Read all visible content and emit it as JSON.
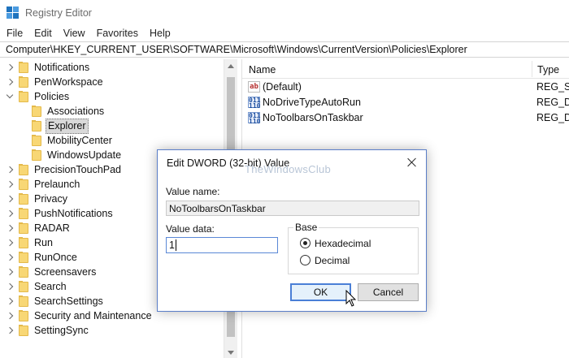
{
  "window": {
    "title": "Registry Editor"
  },
  "menu": [
    "File",
    "Edit",
    "View",
    "Favorites",
    "Help"
  ],
  "address": "Computer\\HKEY_CURRENT_USER\\SOFTWARE\\Microsoft\\Windows\\CurrentVersion\\Policies\\Explorer",
  "tree": {
    "items": [
      {
        "label": "Notifications",
        "level": 0,
        "expander": "collapsed"
      },
      {
        "label": "PenWorkspace",
        "level": 0,
        "expander": "collapsed"
      },
      {
        "label": "Policies",
        "level": 0,
        "expander": "expanded"
      },
      {
        "label": "Associations",
        "level": 1,
        "expander": "none"
      },
      {
        "label": "Explorer",
        "level": 1,
        "expander": "none",
        "selected": true
      },
      {
        "label": "MobilityCenter",
        "level": 1,
        "expander": "none"
      },
      {
        "label": "WindowsUpdate",
        "level": 1,
        "expander": "none"
      },
      {
        "label": "PrecisionTouchPad",
        "level": 0,
        "expander": "collapsed"
      },
      {
        "label": "Prelaunch",
        "level": 0,
        "expander": "collapsed"
      },
      {
        "label": "Privacy",
        "level": 0,
        "expander": "collapsed"
      },
      {
        "label": "PushNotifications",
        "level": 0,
        "expander": "collapsed"
      },
      {
        "label": "RADAR",
        "level": 0,
        "expander": "collapsed"
      },
      {
        "label": "Run",
        "level": 0,
        "expander": "collapsed"
      },
      {
        "label": "RunOnce",
        "level": 0,
        "expander": "collapsed"
      },
      {
        "label": "Screensavers",
        "level": 0,
        "expander": "collapsed"
      },
      {
        "label": "Search",
        "level": 0,
        "expander": "collapsed"
      },
      {
        "label": "SearchSettings",
        "level": 0,
        "expander": "collapsed"
      },
      {
        "label": "Security and Maintenance",
        "level": 0,
        "expander": "collapsed"
      },
      {
        "label": "SettingSync",
        "level": 0,
        "expander": "collapsed"
      }
    ]
  },
  "list": {
    "headers": {
      "name": "Name",
      "type": "Type"
    },
    "rows": [
      {
        "icon": "string-value-icon",
        "glyph": "ab",
        "name": "(Default)",
        "type": "REG_SZ"
      },
      {
        "icon": "dword-value-icon",
        "glyph": "011\n110",
        "name": "NoDriveTypeAutoRun",
        "type": "REG_DV"
      },
      {
        "icon": "dword-value-icon",
        "glyph": "011\n110",
        "name": "NoToolbarsOnTaskbar",
        "type": "REG_DV"
      }
    ]
  },
  "dialog": {
    "title": "Edit DWORD (32-bit) Value",
    "watermark": "TheWindowsClub",
    "value_name_label": "Value name:",
    "value_name": "NoToolbarsOnTaskbar",
    "value_data_label": "Value data:",
    "value_data": "1",
    "base_label": "Base",
    "radios": [
      {
        "label": "Hexadecimal",
        "checked": true
      },
      {
        "label": "Decimal",
        "checked": false
      }
    ],
    "ok": "OK",
    "cancel": "Cancel"
  },
  "colors": {
    "accent": "#1e73be",
    "folder": "#f8d775",
    "dialog_border": "#5a7ec8",
    "default_button_border": "#4a7fd6"
  }
}
